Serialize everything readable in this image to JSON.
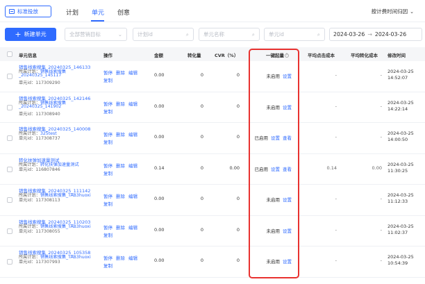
{
  "topbar": {
    "mode_label": "标准投放",
    "tabs": [
      {
        "label": "计划"
      },
      {
        "label": "单元"
      },
      {
        "label": "创意"
      }
    ],
    "time_toggle": "按计费时间归因"
  },
  "filters": {
    "new_button": "新建单元",
    "goal_placeholder": "全部营销目标",
    "plan_id_placeholder": "计划id",
    "unit_name_placeholder": "单元名称",
    "unit_id_placeholder": "单元id",
    "date_start": "2024-03-26",
    "date_end": "2024-03-26"
  },
  "table": {
    "headers": {
      "unit_info": "单元信息",
      "ops": "操作",
      "amount": "金额",
      "conversions": "转化量",
      "cvr": "CVR（%）",
      "boost": "一键起量",
      "avg_click_cost": "平均点击成本",
      "avg_conv_cost": "平均转化成本",
      "modified": "修改时间"
    },
    "ops_labels": {
      "pause": "暂停",
      "delete": "删除",
      "edit": "编辑",
      "copy": "复制"
    },
    "rows": [
      {
        "name1": "销售线索搜集_20240325_146133",
        "name2": "",
        "plan_prefix": "所属计划：",
        "plan1": "销售线索搜集",
        "plan2": "_20240325_145117",
        "unit_id": "单元id：117309290",
        "amount": "0.00",
        "conv": "0",
        "cvr": "0",
        "status": "未启用",
        "link1": "设置",
        "link2": "",
        "click_cost": "-",
        "conv_cost": "-",
        "date": "2024-03-25",
        "time": "14:52:07"
      },
      {
        "name1": "销售线索搜集_20240325_142146",
        "name2": "",
        "plan_prefix": "所属计划：",
        "plan1": "销售线索搜集",
        "plan2": "_20240325_141902",
        "unit_id": "单元id：117308940",
        "amount": "0.00",
        "conv": "0",
        "cvr": "0",
        "status": "未启用",
        "link1": "设置",
        "link2": "",
        "click_cost": "-",
        "conv_cost": "-",
        "date": "2024-03-25",
        "time": "14:22:14"
      },
      {
        "name1": "销售线索搜集_20240325_140008",
        "name2": "",
        "plan_prefix": "所属计划：",
        "plan1": "325test",
        "plan2": "",
        "unit_id": "单元id：117308737",
        "amount": "0.00",
        "conv": "0",
        "cvr": "0",
        "status": "已启用",
        "link1": "设置",
        "link2": "查看",
        "click_cost": "-",
        "conv_cost": "-",
        "date": "2024-03-25",
        "time": "14:00:50"
      },
      {
        "name1": "转化扶弹加速量测试",
        "name2": "",
        "plan_prefix": "所属计划：",
        "plan1": "转化扶弹加速量测试",
        "plan2": "",
        "unit_id": "单元id：116807846",
        "amount": "0.14",
        "conv": "0",
        "cvr": "0.00",
        "status": "已启用",
        "link1": "设置",
        "link2": "查看",
        "click_cost": "0.14",
        "conv_cost": "0.00",
        "date": "2024-03-25",
        "time": "11:30:25"
      },
      {
        "name1": "销售线索搜集_20240325_111142",
        "name2": "",
        "plan_prefix": "所属计划：",
        "plan1": "销售线索搜集_TAB3huoxi",
        "plan2": "",
        "unit_id": "单元id：117308113",
        "amount": "0.00",
        "conv": "0",
        "cvr": "0",
        "status": "未启用",
        "link1": "设置",
        "link2": "",
        "click_cost": "-",
        "conv_cost": "-",
        "date": "2024-03-25",
        "time": "11:12:33"
      },
      {
        "name1": "销售线索搜集_20240325_110203",
        "name2": "",
        "plan_prefix": "所属计划：",
        "plan1": "销售线索搜集_TAB3huoxi",
        "plan2": "",
        "unit_id": "单元id：117308055",
        "amount": "0.00",
        "conv": "0",
        "cvr": "0",
        "status": "未启用",
        "link1": "设置",
        "link2": "",
        "click_cost": "-",
        "conv_cost": "-",
        "date": "2024-03-25",
        "time": "11:02:37"
      },
      {
        "name1": "销售线索搜集_20240325_105358",
        "name2": "",
        "plan_prefix": "所属计划：",
        "plan1": "销售线索搜集_TAB3huoxi",
        "plan2": "",
        "unit_id": "单元id：117307993",
        "amount": "0.00",
        "conv": "0",
        "cvr": "0",
        "status": "未启用",
        "link1": "设置",
        "link2": "",
        "click_cost": "-",
        "conv_cost": "-",
        "date": "2024-03-25",
        "time": "10:54:39"
      }
    ]
  },
  "colors": {
    "accent": "#2f6bff",
    "highlight": "#e8312f"
  }
}
